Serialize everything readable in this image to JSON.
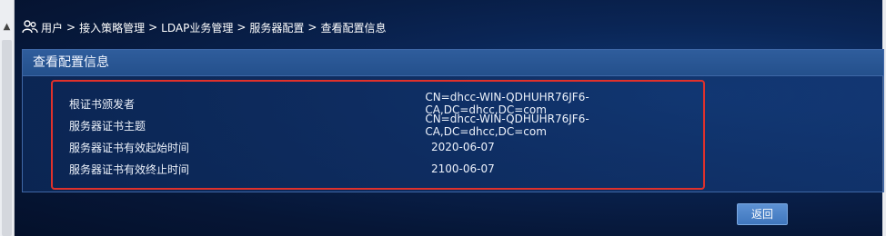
{
  "breadcrumb": {
    "icon": "users-icon",
    "items": [
      "用户",
      "接入策略管理",
      "LDAP业务管理",
      "服务器配置",
      "查看配置信息"
    ],
    "separator": ">"
  },
  "panel": {
    "title": "查看配置信息",
    "rows": [
      {
        "label": "根证书颁发者",
        "value": "CN=dhcc-WIN-QDHUHR76JF6-CA,DC=dhcc,DC=com"
      },
      {
        "label": "服务器证书主题",
        "value": "CN=dhcc-WIN-QDHUHR76JF6-CA,DC=dhcc,DC=com"
      },
      {
        "label": "服务器证书有效起始时间",
        "value": "2020-06-07"
      },
      {
        "label": "服务器证书有效终止时间",
        "value": "2100-06-07"
      }
    ]
  },
  "actions": {
    "back_label": "返回"
  },
  "colors": {
    "highlight_border": "#e0312b",
    "button": "#4a82c8",
    "panel_header": "#2a5694"
  }
}
